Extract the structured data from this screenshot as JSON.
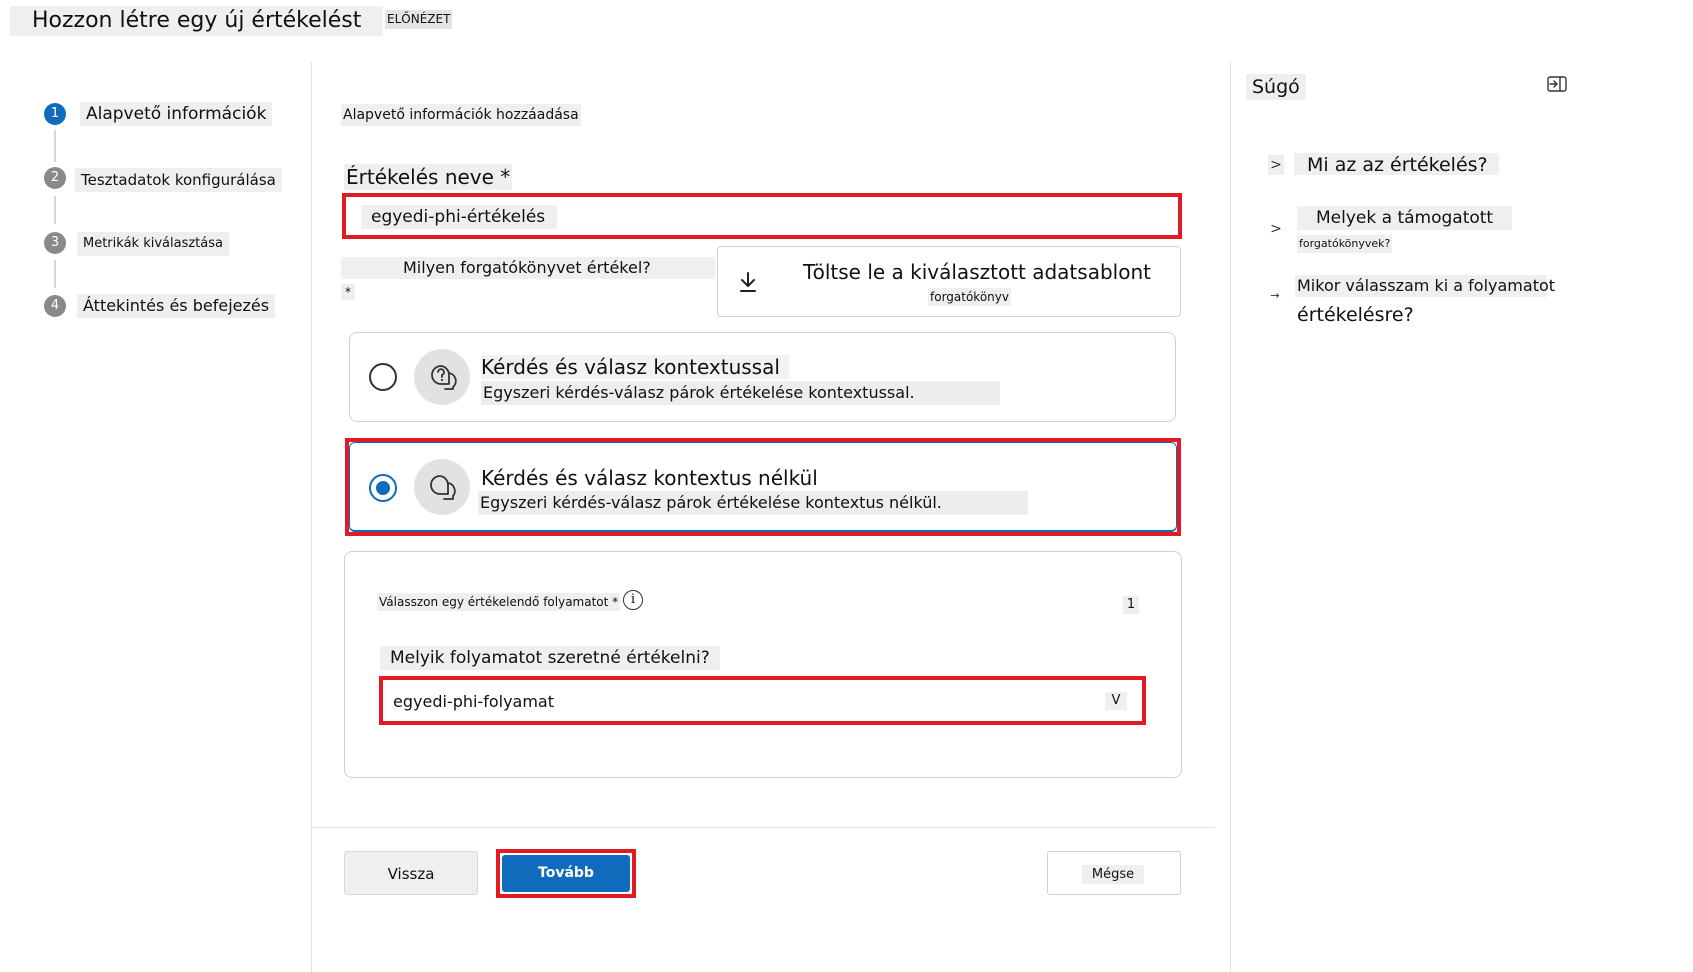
{
  "header": {
    "title": "Hozzon létre egy új értékelést",
    "badge": "ELŐNÉZET"
  },
  "steps": [
    {
      "number": "1",
      "label": "Alapvető információk",
      "active": true
    },
    {
      "number": "2",
      "label": "Tesztadatok konfigurálása",
      "active": false
    },
    {
      "number": "3",
      "label": "Metrikák kiválasztása",
      "active": false
    },
    {
      "number": "4",
      "label": "Áttekintés és befejezés",
      "active": false
    }
  ],
  "form": {
    "section_title": "Alapvető információk hozzáadása",
    "name_label": "Értékelés neve *",
    "name_value": "egyedi-phi-értékelés",
    "scenario_label": "Milyen forgatókönyvet értékel?",
    "scenario_required": "*",
    "download": {
      "title": "Töltse le a kiválasztott adatsablont",
      "subtitle": "forgatókönyv"
    },
    "options": [
      {
        "title": "Kérdés és válasz kontextussal",
        "desc": "Egyszeri kérdés-válasz párok értékelése kontextussal.",
        "selected": false,
        "icon": "qa-context-icon"
      },
      {
        "title": "Kérdés és válasz kontextus nélkül",
        "desc": "Egyszeri kérdés-válasz párok értékelése kontextus nélkül.",
        "selected": true,
        "icon": "chat-icon"
      }
    ],
    "flow": {
      "label": "Válasszon egy értékelendő folyamatot *",
      "info_icon": "info-icon",
      "count": "1",
      "question": "Melyik folyamatot szeretné értékelni?",
      "selected": "egyedi-phi-folyamat",
      "chevron": "V"
    }
  },
  "footer": {
    "back": "Vissza",
    "next": "Tovább",
    "cancel": "Mégse"
  },
  "help": {
    "title": "Súgó",
    "items": [
      {
        "chevron": ">",
        "text": "Mi az az értékelés?"
      },
      {
        "chevron": ">",
        "text": "Melyek a támogatott",
        "sub": "forgatókönyvek?"
      },
      {
        "chevron": "→",
        "text": "Mikor válasszam ki a folyamatot",
        "line2": "értékelésre?"
      }
    ]
  },
  "colors": {
    "accent": "#0f6cbd",
    "highlight": "#e01b24"
  }
}
